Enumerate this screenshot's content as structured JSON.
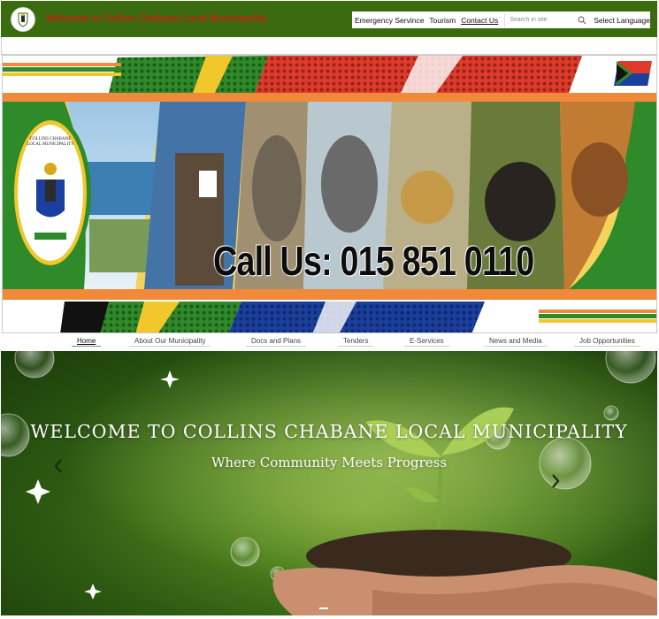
{
  "header": {
    "site_title": "Welcome to Collins Chabane Local Municipality",
    "links": [
      "Emergency Servince",
      "Tourism",
      "Contact Us"
    ],
    "search_placeholder": "Search in site",
    "language_label": "Select Language"
  },
  "banner": {
    "crest_text_top": "COLLINS CHABANE LOCAL MUNICIPALITY",
    "call_us": "Call Us: 015 851 0110",
    "accent_colors": {
      "green": "#2f8a2a",
      "yellow": "#f2c72c",
      "orange": "#f08a3a",
      "red": "#e03a2a",
      "blue": "#1a3f9e"
    }
  },
  "nav": {
    "items": [
      "Home",
      "About Our Municipality",
      "Docs and Plans",
      "Tenders",
      "E-Services",
      "News and Media",
      "Job Opportunities"
    ],
    "active": "Home"
  },
  "hero": {
    "title": "WELCOME TO COLLINS CHABANE LOCAL MUNICIPALITY",
    "subtitle": "Where Community Meets Progress",
    "prev_icon": "chevron-left-icon",
    "next_icon": "chevron-right-icon"
  },
  "colors": {
    "header_bg": "#3a6b0e",
    "title_red": "#c5210f"
  }
}
